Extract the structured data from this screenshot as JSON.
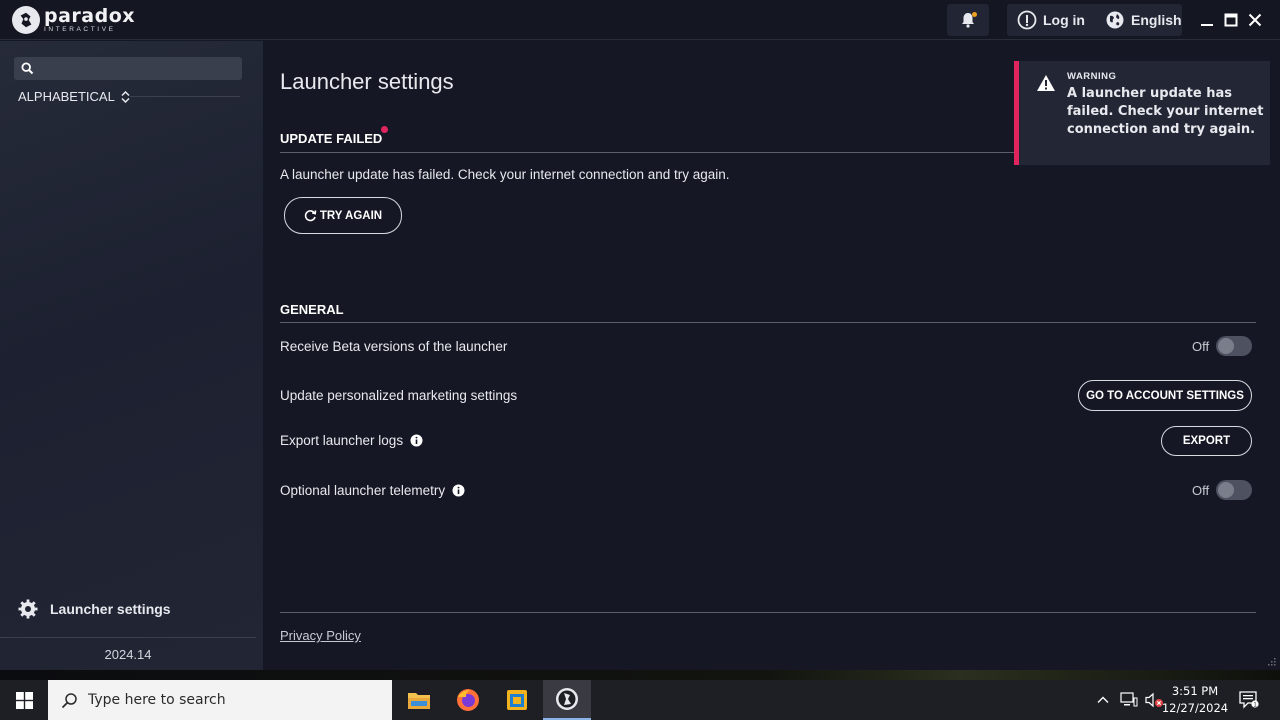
{
  "brand": {
    "name": "paradox",
    "sub": "INTERACTIVE"
  },
  "titlebar": {
    "login_label": "Log in",
    "language_label": "English",
    "icons": [
      "notification-icon",
      "login-icon",
      "globe-icon",
      "minimize-icon",
      "maximize-icon",
      "close-icon"
    ]
  },
  "sidebar": {
    "search_placeholder": "",
    "sort_label": "ALPHABETICAL",
    "settings_label": "Launcher settings",
    "version": "2024.14"
  },
  "main": {
    "title": "Launcher settings",
    "update": {
      "heading": "UPDATE FAILED",
      "message": "A launcher update has failed. Check your internet connection and try again.",
      "try_again_label": "TRY AGAIN"
    },
    "general": {
      "heading": "GENERAL",
      "beta_label": "Receive Beta versions of the launcher",
      "beta_state": "Off",
      "marketing_label": "Update personalized marketing settings",
      "marketing_button": "GO TO ACCOUNT SETTINGS",
      "logs_label": "Export launcher logs",
      "logs_button": "EXPORT",
      "telemetry_label": "Optional launcher telemetry",
      "telemetry_state": "Off"
    },
    "privacy_label": "Privacy Policy"
  },
  "toast": {
    "label": "WARNING",
    "message": "A launcher update has failed. Check your internet connection and try again."
  },
  "taskbar": {
    "search_placeholder": "Type here to search",
    "time": "3:51 PM",
    "date": "12/27/2024"
  },
  "colors": {
    "accent_red": "#e0245e",
    "background": "#151824",
    "sidebar": "#222634"
  }
}
